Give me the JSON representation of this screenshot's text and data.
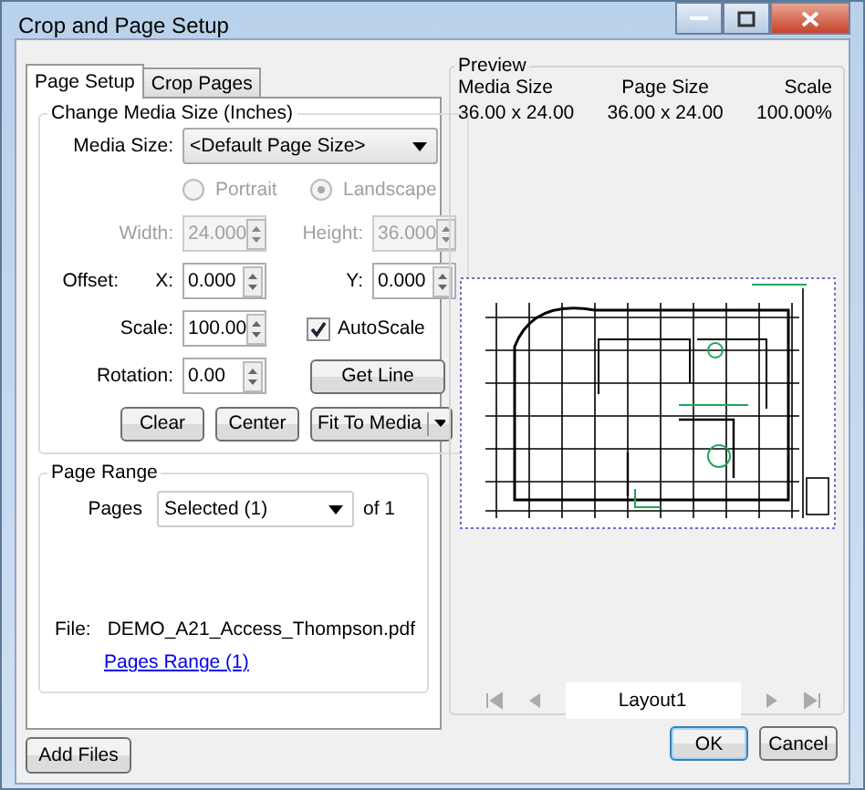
{
  "window": {
    "title": "Crop and Page Setup"
  },
  "tabs": [
    {
      "label": "Page Setup",
      "selected": true
    },
    {
      "label": "Crop Pages",
      "selected": false
    }
  ],
  "media_group": {
    "title": "Change Media Size (Inches)",
    "media_size": {
      "label": "Media Size:",
      "value": "<Default Page Size>"
    },
    "orientation": [
      {
        "label": "Portrait",
        "selected": false,
        "disabled": true
      },
      {
        "label": "Landscape",
        "selected": true,
        "disabled": true
      }
    ],
    "width": {
      "label": "Width:",
      "value": "24.000",
      "disabled": true
    },
    "height": {
      "label": "Height:",
      "value": "36.000",
      "disabled": true
    },
    "offset_label": "Offset:",
    "offset_x": {
      "label": "X:",
      "value": "0.000",
      "disabled": false
    },
    "offset_y": {
      "label": "Y:",
      "value": "0.000",
      "disabled": false
    },
    "scale": {
      "label": "Scale:",
      "value": "100.00",
      "disabled": false
    },
    "autoscale": {
      "label": "AutoScale",
      "checked": true
    },
    "rotation": {
      "label": "Rotation:",
      "value": "0.00",
      "disabled": false
    },
    "get_line": "Get Line",
    "actions": [
      "Clear",
      "Center"
    ],
    "fit_button": "Fit To Media"
  },
  "page_range": {
    "title": "Page Range",
    "pages_label": "Pages",
    "pages_value": "Selected (1)",
    "of_text": "of 1",
    "file_label": "File:",
    "file_name": "DEMO_A21_Access_Thompson.pdf",
    "link": "Pages Range (1)"
  },
  "add_files": "Add Files",
  "preview": {
    "title": "Preview",
    "columns": [
      {
        "heading": "Media Size",
        "value": "36.00 x 24.00"
      },
      {
        "heading": "Page Size",
        "value": "36.00 x 24.00"
      },
      {
        "heading": "Scale",
        "value": "100.00%"
      }
    ],
    "page_name": "Layout1"
  },
  "buttons": [
    "OK",
    "Cancel"
  ]
}
